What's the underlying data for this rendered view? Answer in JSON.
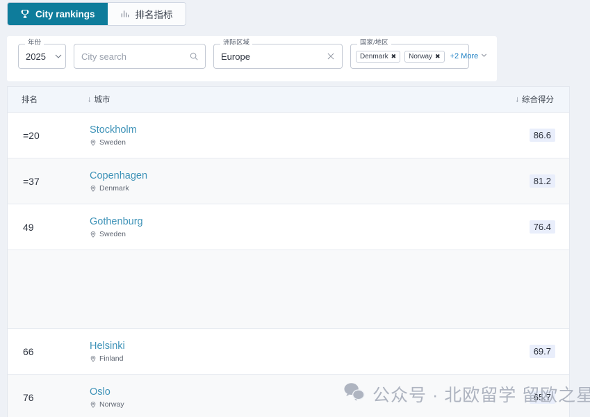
{
  "tabs": [
    {
      "label": "City rankings",
      "icon": "trophy-icon",
      "active": true
    },
    {
      "label": "排名指标",
      "icon": "bar-chart-icon",
      "active": false
    }
  ],
  "filters": {
    "year": {
      "legend": "年份",
      "value": "2025",
      "icon": "chevron-down-icon"
    },
    "search": {
      "legend": "",
      "placeholder": "City search",
      "value": "",
      "icon": "search-icon"
    },
    "region": {
      "legend": "洲际区域",
      "value": "Europe",
      "icon": "close-icon"
    },
    "country": {
      "legend": "国家/地区",
      "chips": [
        "Denmark",
        "Norway"
      ],
      "more_label": "+2 More",
      "chip_remove": "✖"
    }
  },
  "table": {
    "headers": {
      "rank": "排名",
      "city": "城市",
      "score": "综合得分",
      "sort_arrow": "↓"
    },
    "rows": [
      {
        "rank": "=20",
        "city": "Stockholm",
        "country": "Sweden",
        "score": "86.6",
        "blank": false
      },
      {
        "rank": "=37",
        "city": "Copenhagen",
        "country": "Denmark",
        "score": "81.2",
        "blank": false
      },
      {
        "rank": "49",
        "city": "Gothenburg",
        "country": "Sweden",
        "score": "76.4",
        "blank": false
      },
      {
        "rank": "",
        "city": "",
        "country": "",
        "score": "",
        "blank": true
      },
      {
        "rank": "66",
        "city": "Helsinki",
        "country": "Finland",
        "score": "69.7",
        "blank": false
      },
      {
        "rank": "76",
        "city": "Oslo",
        "country": "Norway",
        "score": "65.7",
        "blank": false
      }
    ]
  },
  "watermark": {
    "text": "公众号 · 北欧留学 留欧之星",
    "icon": "wechat-icon"
  },
  "colors": {
    "accent": "#0e7c9b",
    "link": "#3f93b8",
    "page_bg": "#eef1f6",
    "header_bg": "#f2f6fb",
    "score_badge_bg": "#e9eefb",
    "more_link": "#1b7fc4"
  }
}
